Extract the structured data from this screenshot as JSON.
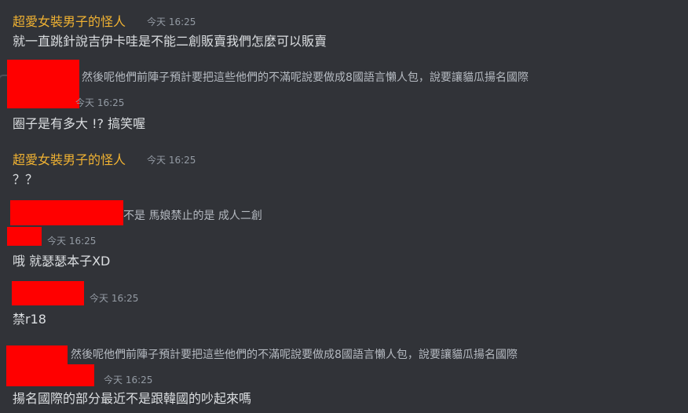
{
  "messages": [
    {
      "author": "超愛女裝男子的怪人",
      "timestamp": "今天 16:25",
      "content": "就一直跳針說吉伊卡哇是不能二創販賣我們怎麼可以販賣"
    },
    {
      "reply_preview": "然後呢他們前陣子預計要把這些他們的不滿呢說要做成8國語言懶人包，說要讓貓瓜揚名國際",
      "timestamp": "今天 16:25",
      "content": "圈子是有多大 !?  搞笑喔"
    },
    {
      "author": "超愛女裝男子的怪人",
      "timestamp": "今天 16:25",
      "content": "？？"
    },
    {
      "reply_preview": "不是 馬娘禁止的是 成人二創",
      "timestamp": "今天 16:25",
      "content": "哦 就瑟瑟本子XD"
    },
    {
      "timestamp": "今天 16:25",
      "content": "禁r18"
    },
    {
      "reply_preview": "然後呢他們前陣子預計要把這些他們的不滿呢說要做成8國語言懶人包，說要讓貓瓜揚名國際",
      "timestamp": "今天 16:25",
      "content": "揚名國際的部分最近不是跟韓國的吵起來嗎"
    }
  ],
  "colors": {
    "background": "#313338",
    "author": "#f0b232",
    "redaction": "#ff0000"
  }
}
